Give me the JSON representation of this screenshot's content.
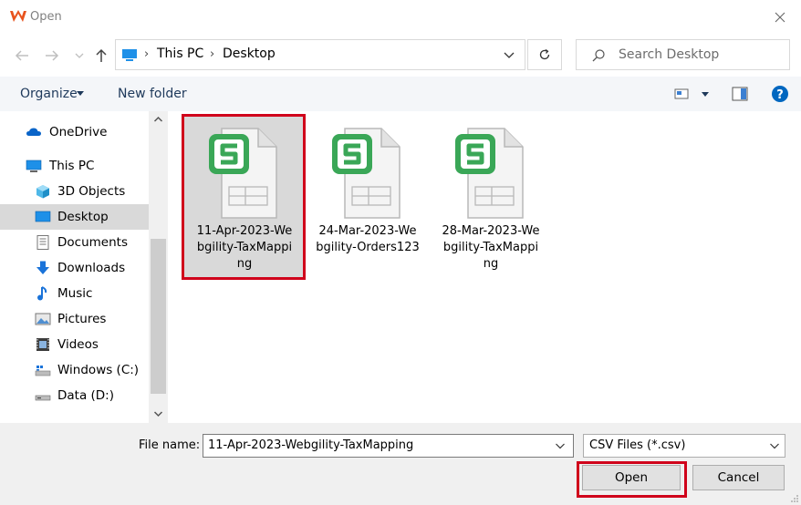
{
  "window": {
    "title": "Open"
  },
  "address": {
    "segments": [
      "This PC",
      "Desktop"
    ]
  },
  "search": {
    "placeholder": "Search Desktop"
  },
  "toolbar": {
    "organize_label": "Organize",
    "new_folder_label": "New folder"
  },
  "sidebar": {
    "items": [
      {
        "label": "OneDrive",
        "icon": "onedrive-icon"
      },
      {
        "label": "This PC",
        "icon": "this-pc-icon"
      },
      {
        "label": "3D Objects",
        "icon": "3d-objects-icon"
      },
      {
        "label": "Desktop",
        "icon": "desktop-icon",
        "selected": true
      },
      {
        "label": "Documents",
        "icon": "documents-icon"
      },
      {
        "label": "Downloads",
        "icon": "downloads-icon"
      },
      {
        "label": "Music",
        "icon": "music-icon"
      },
      {
        "label": "Pictures",
        "icon": "pictures-icon"
      },
      {
        "label": "Videos",
        "icon": "videos-icon"
      },
      {
        "label": "Windows (C:)",
        "icon": "drive-c-icon"
      },
      {
        "label": "Data (D:)",
        "icon": "drive-d-icon"
      }
    ]
  },
  "files": [
    {
      "name": "11-Apr-2023-Webgility-TaxMapping",
      "lines": [
        "11-Apr-2023-We",
        "bgility-TaxMappi",
        "ng"
      ],
      "selected": true
    },
    {
      "name": "24-Mar-2023-Webgility-Orders123",
      "lines": [
        "24-Mar-2023-We",
        "bgility-Orders123"
      ]
    },
    {
      "name": "28-Mar-2023-Webgility-TaxMapping",
      "lines": [
        "28-Mar-2023-We",
        "bgility-TaxMappi",
        "ng"
      ]
    }
  ],
  "footer": {
    "file_name_label": "File name:",
    "file_name_value": "11-Apr-2023-Webgility-TaxMapping",
    "file_type_value": "CSV Files (*.csv)",
    "open_label": "Open",
    "cancel_label": "Cancel"
  },
  "colors": {
    "accent": "#0067c0",
    "highlight": "#d0021b",
    "csv_green": "#3aa757"
  }
}
